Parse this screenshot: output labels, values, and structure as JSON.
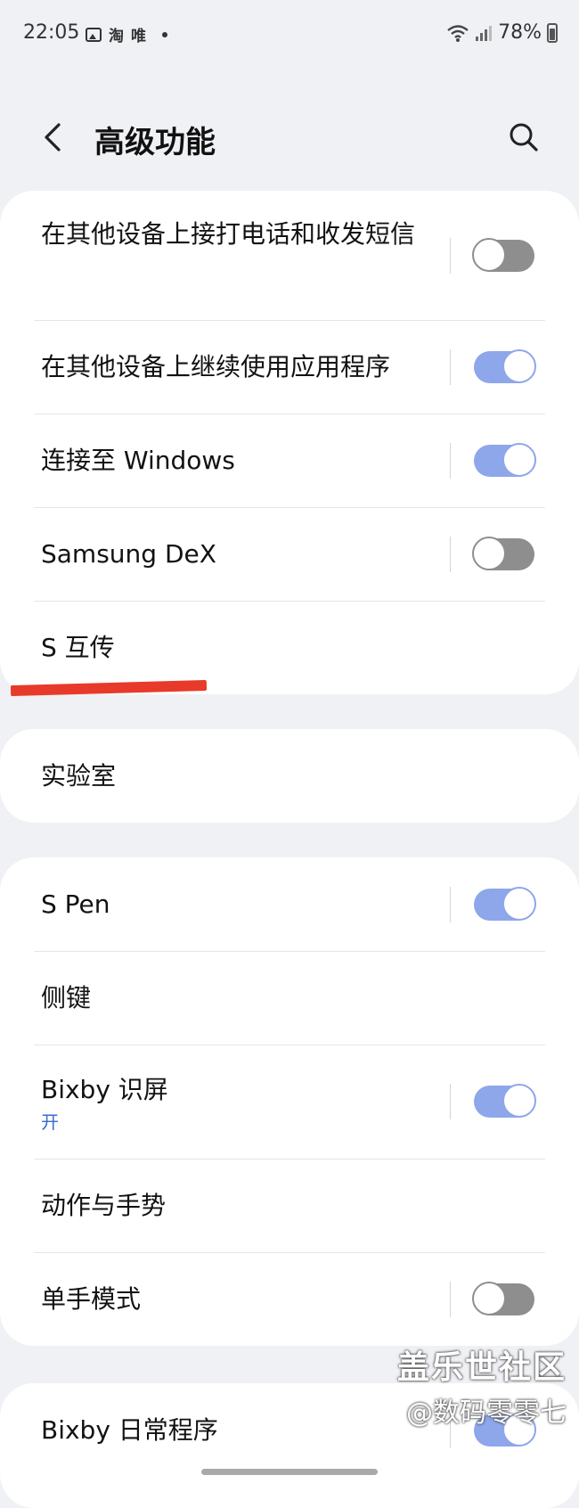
{
  "status_bar": {
    "time": "22:05",
    "app_icons": [
      "image-icon",
      "淘",
      "唯"
    ],
    "battery": "78%"
  },
  "header": {
    "title": "高级功能"
  },
  "group1": [
    {
      "label": "在其他设备上接打电话和收发短信",
      "toggle": "off"
    },
    {
      "label": "在其他设备上继续使用应用程序",
      "toggle": "on"
    },
    {
      "label": "连接至 Windows",
      "toggle": "on"
    },
    {
      "label": "Samsung DeX",
      "toggle": "off"
    },
    {
      "label": "S 互传"
    }
  ],
  "group2": [
    {
      "label": "实验室"
    }
  ],
  "group3": [
    {
      "label": "S Pen",
      "toggle": "on"
    },
    {
      "label": "侧键"
    },
    {
      "label": "Bixby 识屏",
      "sub": "开",
      "toggle": "on"
    },
    {
      "label": "动作与手势"
    },
    {
      "label": "单手模式",
      "toggle": "off"
    }
  ],
  "group4": [
    {
      "label": "Bixby 日常程序",
      "toggle": "on"
    }
  ],
  "watermark": {
    "brand": "盖乐世社区",
    "author": "@数码零零七"
  },
  "colors": {
    "background": "#f0f1f5",
    "card": "#ffffff",
    "toggle_on": "#8ea6ea",
    "toggle_off": "#8e8e8e",
    "annotation": "#e83a2a",
    "sub_text": "#3b6bd0"
  }
}
